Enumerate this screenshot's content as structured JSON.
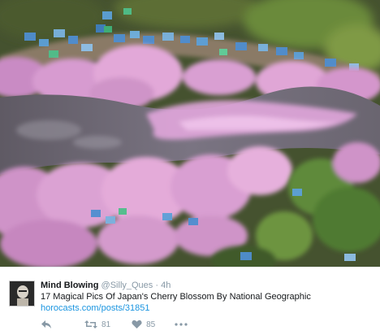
{
  "photo": {
    "subject": "aerial-cherry-blossom-river"
  },
  "tweet": {
    "display_name": "Mind Blowing",
    "handle": "@Silly_Ques",
    "separator": "·",
    "time": "4h",
    "text": "17 Magical Pics Of Japan's Cherry Blossom By National Geographic",
    "link": "horocasts.com/posts/31851",
    "retweet_count": "81",
    "like_count": "85"
  },
  "icons": {
    "reply": "reply-icon",
    "retweet": "retweet-icon",
    "like": "heart-icon",
    "more": "more-dots-icon"
  },
  "colors": {
    "link": "#1b95e0",
    "muted": "#8899a6",
    "blossom": "#e8a3d8",
    "river": "#6d6870"
  }
}
